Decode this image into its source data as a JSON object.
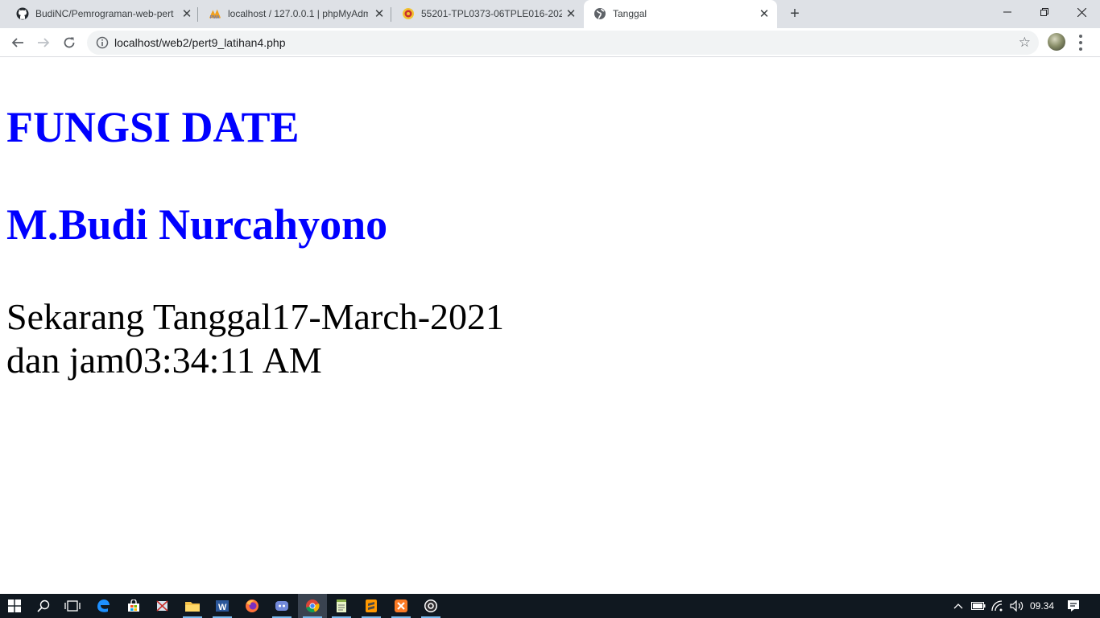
{
  "browser": {
    "tabs": [
      {
        "title": "BudiNC/Pemrograman-web-pert",
        "icon": "github-icon"
      },
      {
        "title": "localhost / 127.0.0.1 | phpMyAdm",
        "icon": "phpmyadmin-icon"
      },
      {
        "title": "55201-TPL0373-06TPLE016-2020",
        "icon": "university-icon"
      },
      {
        "title": "Tanggal",
        "icon": "globe-icon"
      }
    ],
    "new_tab_label": "+",
    "address": "localhost/web2/pert9_latihan4.php"
  },
  "page": {
    "heading1": "FUNGSI DATE",
    "heading2": "M.Budi Nurcahyono",
    "line1": "Sekarang Tanggal17-March-2021",
    "line2": "dan jam03:34:11 AM"
  },
  "taskbar": {
    "clock": "09.34",
    "apps": [
      "start",
      "search",
      "task-view",
      "edge",
      "store",
      "snipping",
      "file-explorer",
      "word",
      "firefox",
      "discord",
      "chrome",
      "notepad",
      "sublime-text",
      "xampp",
      "obs"
    ]
  },
  "colors": {
    "heading": "#0000ff",
    "tabstrip": "#dee1e6",
    "taskbar": "#101820"
  }
}
